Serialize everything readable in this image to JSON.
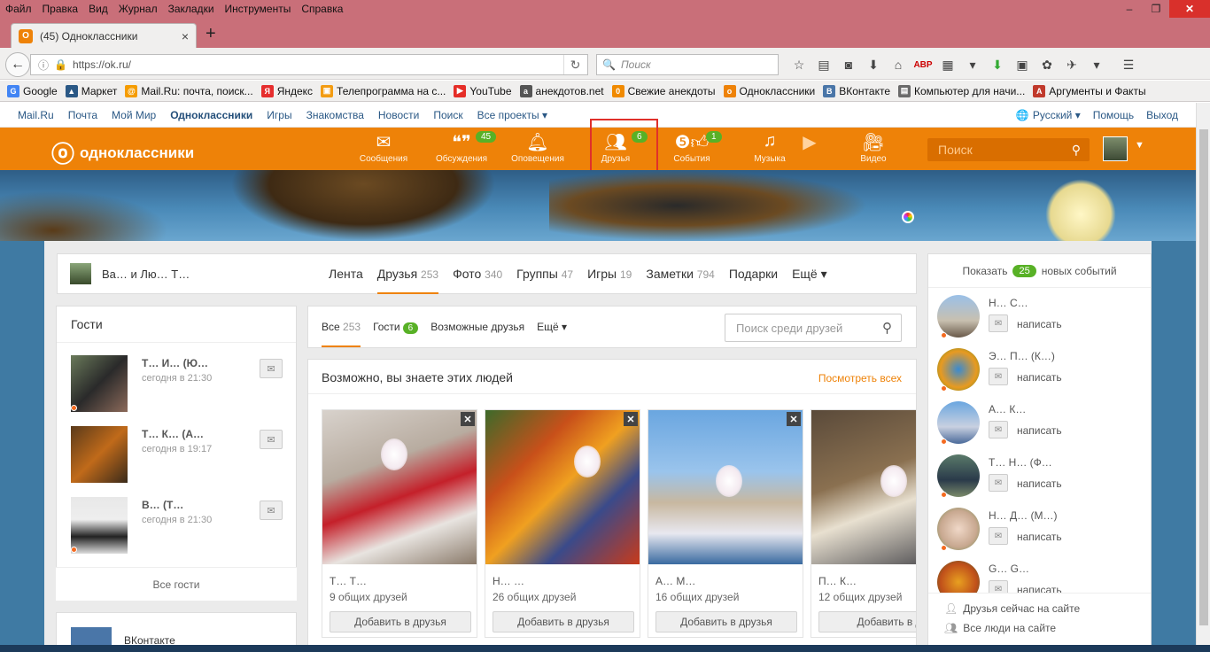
{
  "menubar": [
    "Файл",
    "Правка",
    "Вид",
    "Журнал",
    "Закладки",
    "Инструменты",
    "Справка"
  ],
  "window_controls": {
    "minimize": "–",
    "restore": "❐",
    "close": "✕"
  },
  "tab": {
    "title": "(45) Одноклассники",
    "favicon": "ok",
    "close": "×"
  },
  "new_tab": "+",
  "url": "https://ok.ru/",
  "search_placeholder": "Поиск",
  "bookmarks": [
    {
      "label": "Google",
      "color": "#4285f4",
      "glyph": "G"
    },
    {
      "label": "Маркет",
      "color": "#2a5885",
      "glyph": "🛒"
    },
    {
      "label": "Mail.Ru: почта, поиск...",
      "color": "#f59c00",
      "glyph": "@"
    },
    {
      "label": "Яндекс",
      "color": "#e62e2e",
      "glyph": "Я"
    },
    {
      "label": "Телепрограмма на с...",
      "color": "#f39c12",
      "glyph": "▣"
    },
    {
      "label": "YouTube",
      "color": "#e52d27",
      "glyph": "▶"
    },
    {
      "label": "анекдотов.net",
      "color": "#555",
      "glyph": "a"
    },
    {
      "label": "Свежие анекдоты",
      "color": "#f08a00",
      "glyph": "0"
    },
    {
      "label": "Одноклассники",
      "color": "#ee8208",
      "glyph": "o"
    },
    {
      "label": "ВКонтакте",
      "color": "#4a76a8",
      "glyph": "В"
    },
    {
      "label": "Компьютер для начи...",
      "color": "#6a6a6a",
      "glyph": "▤"
    },
    {
      "label": "Аргументы и Факты",
      "color": "#c0392b",
      "glyph": "A"
    }
  ],
  "toplinks": {
    "left": [
      "Mail.Ru",
      "Почта",
      "Мой Мир",
      "Одноклассники",
      "Игры",
      "Знакомства",
      "Новости",
      "Поиск",
      "Все проекты ▾"
    ],
    "lang": "Русский ▾",
    "help": "Помощь",
    "exit": "Выход"
  },
  "ok": {
    "logo": "одноклассники",
    "nav": [
      {
        "label": "Сообщения",
        "icon": "envelope-icon",
        "glyph": "✉",
        "badge": ""
      },
      {
        "label": "Обсуждения",
        "icon": "discussions-icon",
        "glyph": "💬",
        "badge": "45"
      },
      {
        "label": "Оповещения",
        "icon": "bell-icon",
        "glyph": "🔔",
        "badge": ""
      },
      {
        "label": "Друзья",
        "icon": "friends-icon",
        "glyph": "👥",
        "badge": "6"
      },
      {
        "label": "События",
        "icon": "events-icon",
        "glyph": "👍",
        "badge": "1"
      },
      {
        "label": "Музыка",
        "icon": "music-icon",
        "glyph": "♫",
        "badge": ""
      },
      {
        "label": "",
        "icon": "play-icon",
        "glyph": "▶",
        "badge": ""
      },
      {
        "label": "Видео",
        "icon": "video-icon",
        "glyph": "🎥",
        "badge": ""
      }
    ],
    "search_placeholder": "Поиск"
  },
  "profile": {
    "name": "Ва… и Лю… Т…",
    "tabs": [
      {
        "label": "Лента",
        "count": ""
      },
      {
        "label": "Друзья",
        "count": "253"
      },
      {
        "label": "Фото",
        "count": "340"
      },
      {
        "label": "Группы",
        "count": "47"
      },
      {
        "label": "Игры",
        "count": "19"
      },
      {
        "label": "Заметки",
        "count": "794"
      },
      {
        "label": "Подарки",
        "count": ""
      },
      {
        "label": "Ещё ▾",
        "count": ""
      }
    ]
  },
  "guests": {
    "title": "Гости",
    "items": [
      {
        "name": "Т… И… (Ю…",
        "time": "сегодня в 21:30"
      },
      {
        "name": "Т… К… (А…",
        "time": "сегодня в 19:17"
      },
      {
        "name": "В… (Т…",
        "time": "сегодня в 21:30"
      }
    ],
    "all": "Все гости"
  },
  "vk": {
    "title": "ВКонтакте"
  },
  "friendtabs": {
    "all_label": "Все",
    "all_count": "253",
    "guests_label": "Гости",
    "guests_count": "6",
    "possible": "Возможные друзья",
    "more": "Ещё ▾",
    "search_placeholder": "Поиск среди друзей"
  },
  "suggest": {
    "title": "Возможно, вы знаете этих людей",
    "see_all": "Посмотреть всех",
    "cards": [
      {
        "name": "Т… Т…",
        "mutual": "9 общих друзей",
        "button": "Добавить в друзья"
      },
      {
        "name": "Н… …",
        "mutual": "26 общих друзей",
        "button": "Добавить в друзья"
      },
      {
        "name": "А… М…",
        "mutual": "16 общих друзей",
        "button": "Добавить в друзья"
      },
      {
        "name": "П… К…",
        "mutual": "12 общих друзей",
        "button": "Добавить в д"
      }
    ]
  },
  "rightcol": {
    "show": "Показать",
    "count": "25",
    "events": "новых событий",
    "users": [
      {
        "name": "Н… С…",
        "write": "написать"
      },
      {
        "name": "Э… П… (К…)",
        "write": "написать"
      },
      {
        "name": "А… К…",
        "write": "написать"
      },
      {
        "name": "Т… Н… (Ф…",
        "write": "написать"
      },
      {
        "name": "Н… Д… (М…)",
        "write": "написать"
      },
      {
        "name": "G… G…",
        "write": "написать"
      }
    ],
    "online": "Друзья сейчас на сайте",
    "all_online": "Все люди на сайте"
  }
}
